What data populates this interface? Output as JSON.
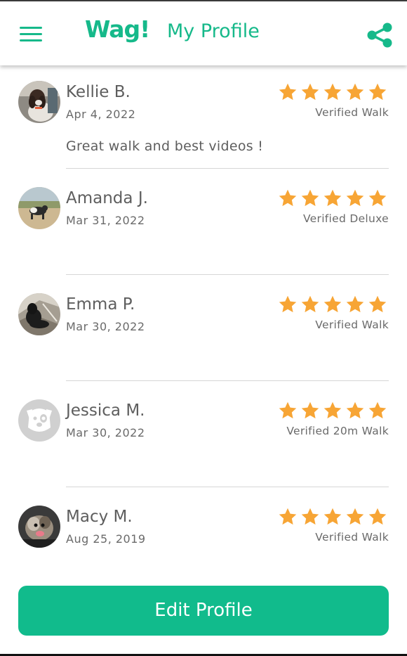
{
  "header": {
    "logo": "Wag!",
    "title": "My Profile"
  },
  "colors": {
    "brand": "#16b98a",
    "star": "#f7a535",
    "button": "#11bb8c"
  },
  "reviews": [
    {
      "name": "Kellie B.",
      "date": "Apr 4, 2022",
      "rating": 5,
      "verified": "Verified Walk",
      "comment": "Great walk and best videos !",
      "avatar": "dog-photo-avatar"
    },
    {
      "name": "Amanda J.",
      "date": "Mar 31, 2022",
      "rating": 5,
      "verified": "Verified Deluxe",
      "comment": "",
      "avatar": "dog-on-beach-avatar"
    },
    {
      "name": "Emma P.",
      "date": "Mar 30, 2022",
      "rating": 5,
      "verified": "Verified Walk",
      "comment": "",
      "avatar": "black-dog-avatar"
    },
    {
      "name": "Jessica M.",
      "date": "Mar 30, 2022",
      "rating": 5,
      "verified": "Verified 20m Walk",
      "comment": "",
      "avatar": "default-dog-avatar"
    },
    {
      "name": "Macy M.",
      "date": "Aug 25, 2019",
      "rating": 5,
      "verified": "Verified Walk",
      "comment": "",
      "avatar": "small-dog-avatar"
    }
  ],
  "footer": {
    "edit_label": "Edit Profile"
  }
}
